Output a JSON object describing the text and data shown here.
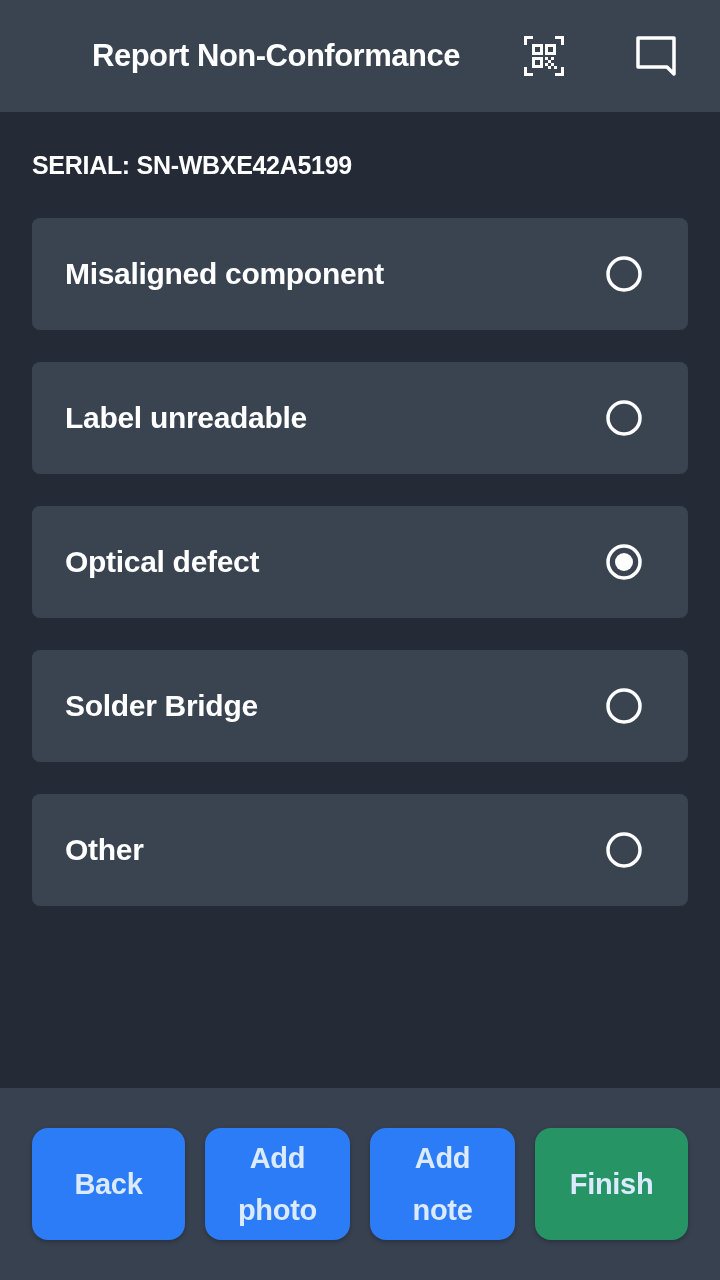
{
  "header": {
    "title": "Report Non-Conformance"
  },
  "serial": "SERIAL: SN-WBXE42A5199",
  "options": [
    {
      "label": "Misaligned component",
      "selected": false
    },
    {
      "label": "Label unreadable",
      "selected": false
    },
    {
      "label": "Optical defect",
      "selected": true
    },
    {
      "label": "Solder Bridge",
      "selected": false
    },
    {
      "label": "Other",
      "selected": false
    }
  ],
  "buttons": [
    {
      "label": "Back",
      "kind": "primary"
    },
    {
      "label": "Add photo",
      "kind": "primary"
    },
    {
      "label": "Add note",
      "kind": "primary"
    },
    {
      "label": "Finish",
      "kind": "success"
    }
  ]
}
